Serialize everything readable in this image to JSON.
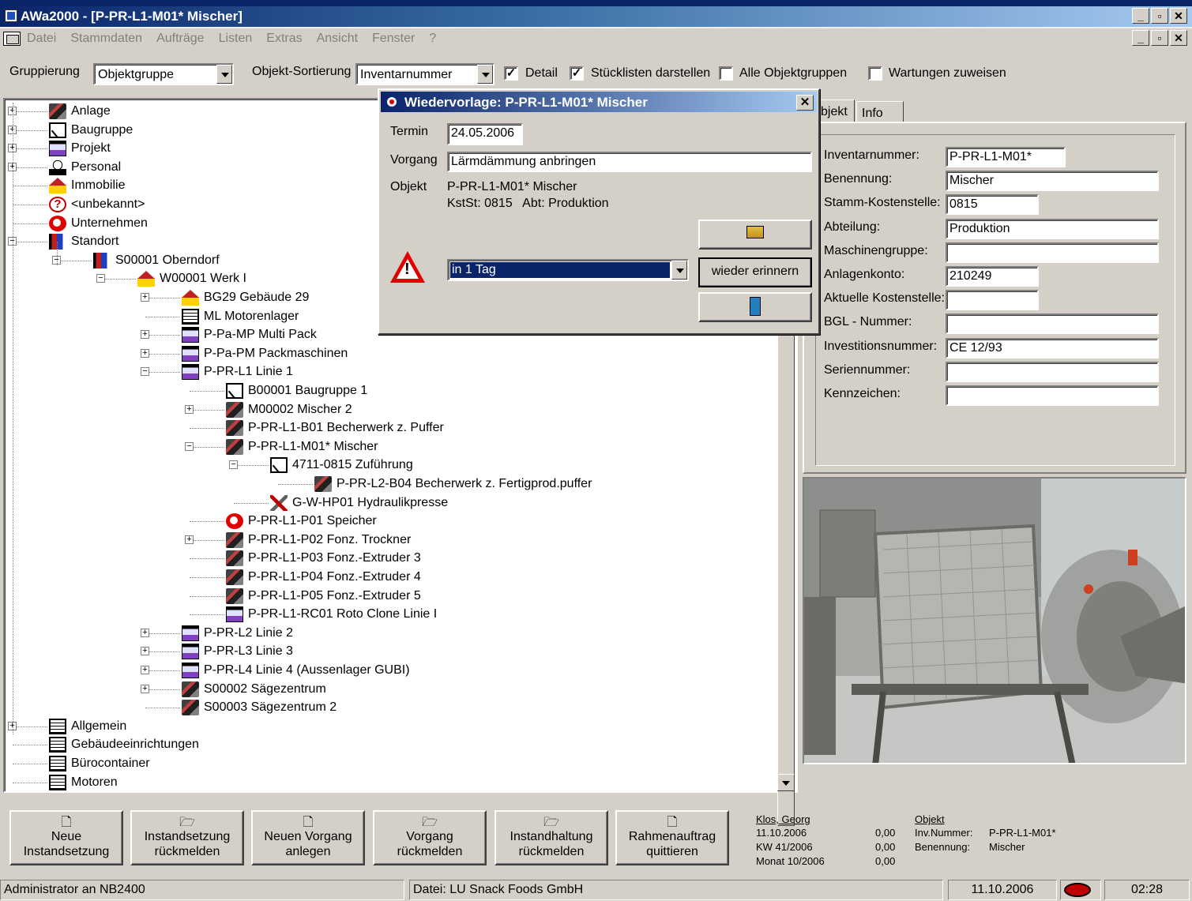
{
  "window": {
    "title": "AWa2000 - [P-PR-L1-M01* Mischer]"
  },
  "menu": [
    {
      "label": "Datei",
      "u": "D",
      "rest": "atei"
    },
    {
      "label": "Stammdaten",
      "u": "S",
      "rest": "tammdaten"
    },
    {
      "label": "Aufträge",
      "u": "",
      "rest": "Aufträge"
    },
    {
      "label": "Listen",
      "u": "L",
      "rest": "isten"
    },
    {
      "label": "Extras",
      "u": "",
      "rest": "Extras"
    },
    {
      "label": "Ansicht",
      "u": "A",
      "rest": "nsicht"
    },
    {
      "label": "Fenster",
      "u": "F",
      "rest": "enster"
    },
    {
      "label": "?",
      "u": "?",
      "rest": ""
    }
  ],
  "toolbar": {
    "gruppierung_label": "Gruppierung",
    "gruppierung_value": "Objektgruppe",
    "sortierung_label": "Objekt-Sortierung",
    "sortierung_value": "Inventarnummer",
    "detail_label": "Detail",
    "detail_checked": "✓",
    "stueck_label": "Stücklisten darstellen",
    "stueck_checked": "✓",
    "alle_label": "Alle Objektgruppen",
    "wartungen_label": "Wartungen zuweisen"
  },
  "tree": [
    {
      "label": "Anlage",
      "icon": "machine-icon"
    },
    {
      "label": "Baugruppe",
      "icon": "assembly-icon"
    },
    {
      "label": "Projekt",
      "icon": "project-icon"
    },
    {
      "label": "Personal",
      "icon": "person-icon"
    },
    {
      "label": "Immobilie",
      "icon": "house-icon"
    },
    {
      "label": "<unbekannt>",
      "icon": "question-icon"
    },
    {
      "label": "Unternehmen",
      "icon": "company-icon"
    },
    {
      "label": "Standort",
      "icon": "location-icon"
    },
    {
      "label": "S00001 Oberndorf",
      "icon": "location-icon"
    },
    {
      "label": "W00001 Werk I",
      "icon": "house-icon"
    },
    {
      "label": "BG29 Gebäude 29",
      "icon": "house-icon"
    },
    {
      "label": "ML Motorenlager",
      "icon": "cabinet-icon"
    },
    {
      "label": "P-Pa-MP Multi Pack",
      "icon": "project-icon"
    },
    {
      "label": "P-Pa-PM Packmaschinen",
      "icon": "project-icon"
    },
    {
      "label": "P-PR-L1 Linie 1",
      "icon": "project-icon"
    },
    {
      "label": "B00001 Baugruppe 1",
      "icon": "assembly-icon"
    },
    {
      "label": "M00002 Mischer 2",
      "icon": "machine-icon"
    },
    {
      "label": "P-PR-L1-B01 Becherwerk z. Puffer",
      "icon": "machine-icon"
    },
    {
      "label": "P-PR-L1-M01* Mischer",
      "icon": "machine-icon"
    },
    {
      "label": "4711-0815 Zuführung",
      "icon": "assembly-icon"
    },
    {
      "label": "P-PR-L2-B04 Becherwerk z. Fertigprod.puffer",
      "icon": "machine-icon"
    },
    {
      "label": "G-W-HP01 Hydraulikpresse",
      "icon": "tool-icon"
    },
    {
      "label": "P-PR-L1-P01 Speicher",
      "icon": "company-icon"
    },
    {
      "label": "P-PR-L1-P02 Fonz. Trockner",
      "icon": "machine-icon"
    },
    {
      "label": "P-PR-L1-P03 Fonz.-Extruder 3",
      "icon": "machine-icon"
    },
    {
      "label": "P-PR-L1-P04 Fonz.-Extruder 4",
      "icon": "machine-icon"
    },
    {
      "label": "P-PR-L1-P05 Fonz.-Extruder 5",
      "icon": "machine-icon"
    },
    {
      "label": "P-PR-L1-RC01 Roto Clone Linie I",
      "icon": "project-icon"
    },
    {
      "label": "P-PR-L2 Linie 2",
      "icon": "project-icon"
    },
    {
      "label": "P-PR-L3 Linie 3",
      "icon": "project-icon"
    },
    {
      "label": "P-PR-L4 Linie 4 (Aussenlager GUBI)",
      "icon": "project-icon"
    },
    {
      "label": "S00002 Sägezentrum",
      "icon": "machine-icon"
    },
    {
      "label": "S00003 Sägezentrum 2",
      "icon": "machine-icon"
    },
    {
      "label": "Allgemein",
      "icon": "cabinet-icon"
    },
    {
      "label": "Gebäudeeinrichtungen",
      "icon": "cabinet-icon"
    },
    {
      "label": "Bürocontainer",
      "icon": "cabinet-icon"
    },
    {
      "label": "Motoren",
      "icon": "cabinet-icon"
    }
  ],
  "tabs": {
    "objekt": "bjekt",
    "info": "Info"
  },
  "props": {
    "labels": [
      "Inventarnummer:",
      "Benennung:",
      "Stamm-Kostenstelle:",
      "Abteilung:",
      "Maschinengruppe:",
      "Anlagenkonto:",
      "Aktuelle Kostenstelle:",
      "BGL - Nummer:",
      "Investitionsnummer:",
      "Seriennummer:",
      "Kennzeichen:"
    ],
    "values": [
      "P-PR-L1-M01*",
      "Mischer",
      "0815",
      "Produktion",
      "",
      "210249",
      "",
      "",
      "CE 12/93",
      "",
      ""
    ]
  },
  "dialog": {
    "title": "Wiedervorlage: P-PR-L1-M01* Mischer",
    "termin_label": "Termin",
    "termin_value": "24.05.2006",
    "vorgang_label": "Vorgang",
    "vorgang_value": "Lärmdämmung anbringen",
    "objekt_label": "Objekt",
    "objekt_line1": "P-PR-L1-M01* Mischer",
    "objekt_line2": "KstSt: 0815   Abt: Produktion",
    "remind_value": "in 1 Tag",
    "remind_button": "wieder erinnern",
    "warn_glyph": "!"
  },
  "bottom_buttons": [
    {
      "line1": "Neue",
      "line2": "Instandsetzung",
      "icon": "new-doc-icon"
    },
    {
      "line1": "Instandsetzung",
      "line2": "rückmelden",
      "icon": "folder-open-icon"
    },
    {
      "line1": "Neuen Vorgang",
      "line2": "anlegen",
      "icon": "new-doc-icon"
    },
    {
      "line1": "Vorgang",
      "line2": "rückmelden",
      "icon": "folder-open-icon"
    },
    {
      "line1": "Instandhaltung",
      "line2": "rückmelden",
      "icon": "folder-open-icon"
    },
    {
      "line1": "Rahmenauftrag",
      "line2": "quittieren",
      "icon": "new-doc-icon"
    }
  ],
  "info": {
    "user": "Klos, Georg",
    "date": "11.10.2006",
    "kw": "KW 41/2006",
    "monat": "Monat 10/2006",
    "v1": "0,00",
    "v2": "0,00",
    "v3": "0,00",
    "objekt_head": "Objekt",
    "inv_label": "Inv.Nummer:",
    "inv_value": "P-PR-L1-M01*",
    "ben_label": "Benennung:",
    "ben_value": "Mischer"
  },
  "status": {
    "user": "Administrator an NB2400",
    "datei": "Datei: LU Snack Foods GmbH",
    "date": "11.10.2006",
    "time": "02:28"
  }
}
